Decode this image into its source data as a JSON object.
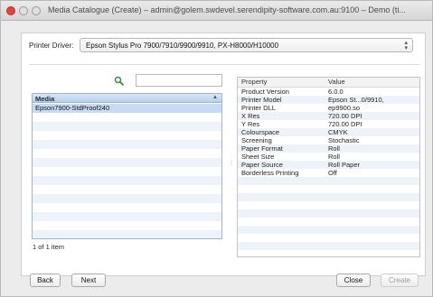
{
  "window": {
    "title": "Media Catalogue (Create) – admin@golem.swdevel.serendipity-software.com.au:9100 – Demo (ti..."
  },
  "driver": {
    "label": "Printer Driver:",
    "selected": "Epson Stylus Pro 7900/7910/9900/9910, PX-H8000/H10000"
  },
  "media": {
    "search_value": "",
    "column_header": "Media",
    "items": [
      "Epson7900-StdProof240"
    ],
    "count_text": "1 of 1 item"
  },
  "properties": {
    "header_property": "Property",
    "header_value": "Value",
    "rows": [
      {
        "property": "Product Version",
        "value": "6.0.0"
      },
      {
        "property": "Printer Model",
        "value": "Epson St...0/9910,"
      },
      {
        "property": "Printer DLL",
        "value": "ep9900.so"
      },
      {
        "property": "X Res",
        "value": "720.00 DPI"
      },
      {
        "property": "Y Res",
        "value": "720.00 DPI"
      },
      {
        "property": "Colourspace",
        "value": "CMYK"
      },
      {
        "property": "Screening",
        "value": "Stochastic"
      },
      {
        "property": "Paper Format",
        "value": "Roll"
      },
      {
        "property": "Sheet Size",
        "value": "Roll"
      },
      {
        "property": "Paper Source",
        "value": "Roll Paper"
      },
      {
        "property": "Borderless Printing",
        "value": "Off"
      }
    ]
  },
  "buttons": {
    "back": "Back",
    "next": "Next",
    "close": "Close",
    "create": "Create"
  },
  "colors": {
    "selection": "#c9dbf2",
    "close_button": "#e0443e"
  }
}
